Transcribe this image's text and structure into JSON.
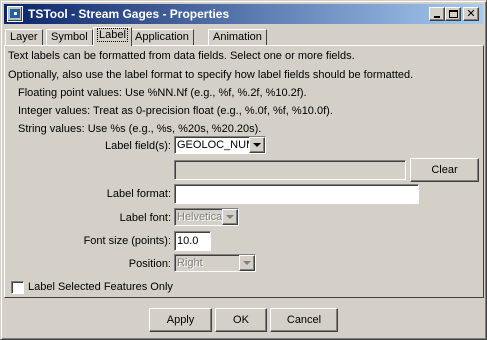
{
  "window": {
    "title": "TSTool - Stream Gages - Properties",
    "controls": {
      "minimize": "minimize",
      "maximize": "maximize",
      "close": "✕"
    }
  },
  "tabs": [
    {
      "label": "Layer",
      "active": false
    },
    {
      "label": "Symbol",
      "active": false
    },
    {
      "label": "Label",
      "active": true
    },
    {
      "label": "Application",
      "active": false
    },
    {
      "label": "Animation",
      "active": false
    }
  ],
  "help": {
    "line1": "Text labels can  be formatted from data fields.  Select one or more fields.",
    "line2": "Optionally, also use  the label format to specify how label fields should be formatted.",
    "line3": "Floating point values:  Use %NN.Nf (e.g., %f, %.2f, %10.2f).",
    "line4": "Integer values:  Treat as 0-precision float (e.g., %.0f, %f, %10.0f).",
    "line5": "String values:  Use %s (e.g., %s, %20s, %20.20s)."
  },
  "form": {
    "label_fields": {
      "label": "Label field(s):",
      "value": "GEOLOC_NUM"
    },
    "selected_fields": {
      "value": ""
    },
    "clear_button": "Clear",
    "label_format": {
      "label": "Label format:",
      "value": ""
    },
    "label_font": {
      "label": "Label font:",
      "value": "Helvetica"
    },
    "font_size": {
      "label": "Font size (points):",
      "value": "10.0"
    },
    "position": {
      "label": "Position:",
      "value": "Right"
    },
    "label_selected_only": {
      "label": "Label Selected Features Only",
      "checked": false
    }
  },
  "buttons": {
    "apply": "Apply",
    "ok": "OK",
    "cancel": "Cancel"
  },
  "colors": {
    "title_gradient_start": "#0a246a",
    "title_gradient_end": "#a6caf0",
    "face": "#d4d0c8"
  }
}
